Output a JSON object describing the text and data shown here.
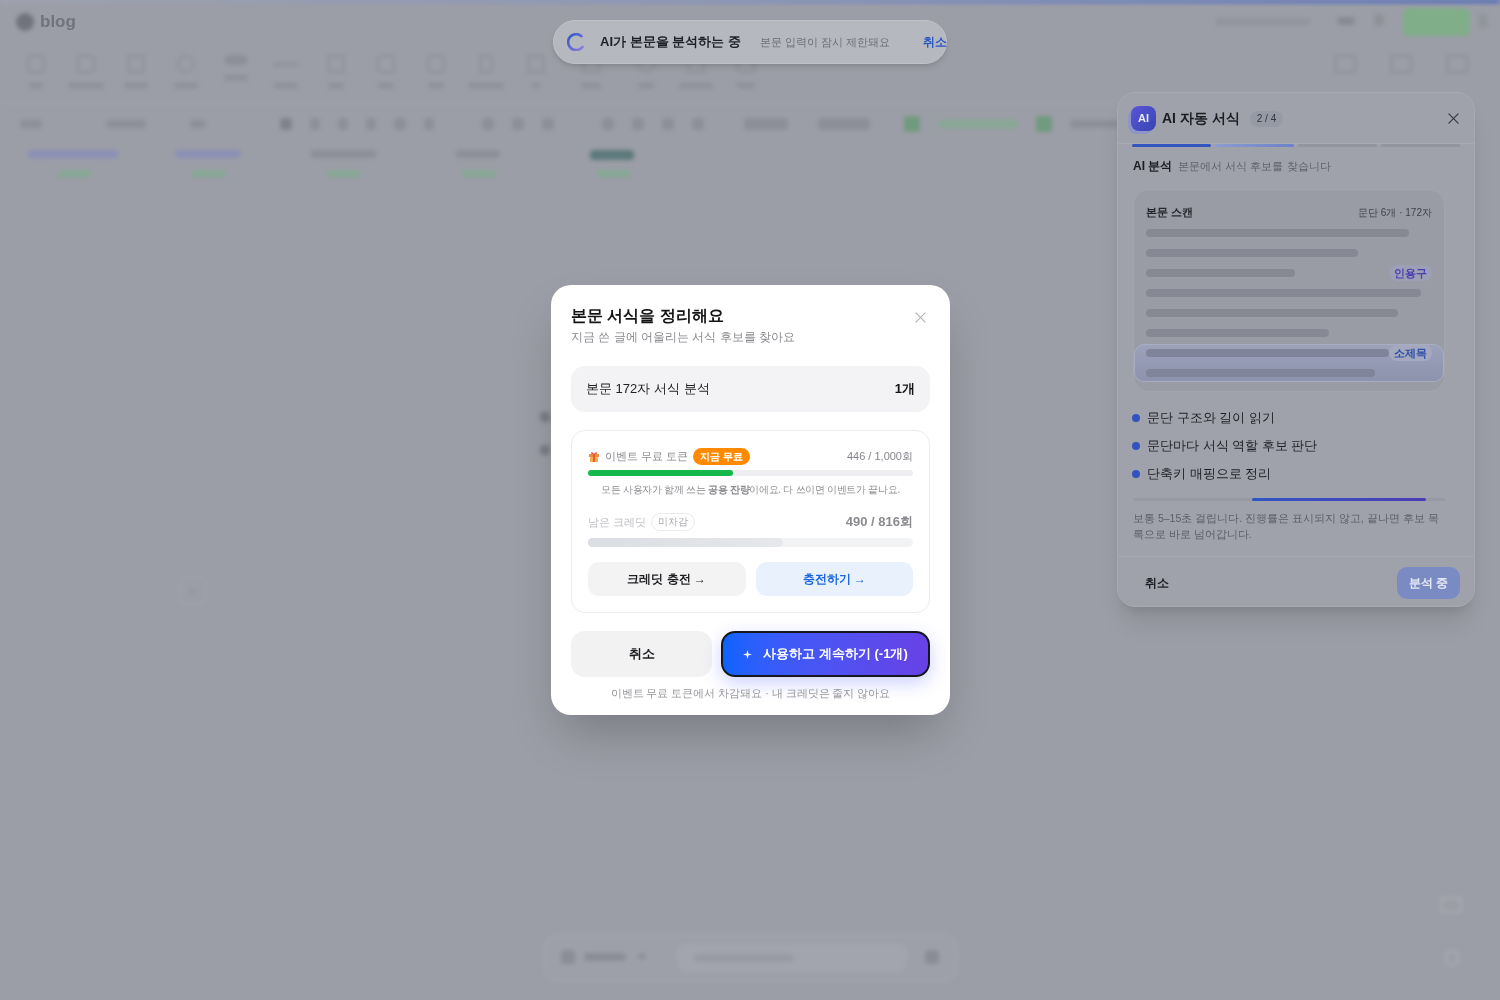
{
  "background": {
    "logo": "blog"
  },
  "toast": {
    "title": "AI가 본문을 분석하는 중",
    "message": "본문 입력이 잠시 제한돼요",
    "action": "취소"
  },
  "side_panel": {
    "logo": "AI",
    "title": "AI 자동 서식",
    "step_counter": "2 / 4",
    "steps": [
      {
        "completed": true,
        "current": false
      },
      {
        "completed": false,
        "current": true
      },
      {
        "completed": false,
        "current": false
      },
      {
        "completed": false,
        "current": false
      }
    ],
    "section_title": "AI 분석",
    "section_subtitle": "본문에서 서식 후보를 찾습니다",
    "scan": {
      "title": "본문 스캔",
      "meta": "문단 6개 · 172자",
      "lines": [
        {
          "highlighted": false
        },
        {
          "highlighted": false
        },
        {
          "highlighted": false,
          "tag": {
            "label": "인용구",
            "kind": "quote"
          }
        },
        {
          "highlighted": false
        },
        {
          "highlighted": false
        },
        {
          "highlighted": false
        },
        {
          "highlighted": true,
          "tag": {
            "label": "소제목",
            "kind": "subheading"
          }
        },
        {
          "highlighted": true
        }
      ]
    },
    "checklist": [
      "문단 구조와 길이 읽기",
      "문단마다 서식 역할 후보 판단",
      "단축키 매핑으로 정리"
    ],
    "progress": {
      "indeterminate": true
    },
    "note": "보통 5–15초 걸립니다. 진행률은 표시되지 않고, 끝나면 후보 목록으로 바로 넘어갑니다.",
    "cancel": "취소",
    "submit": {
      "label": "분석 중",
      "disabled": true
    }
  },
  "dialog": {
    "title": "본문 서식을 정리해요",
    "subtitle": "지금 쓴 글에 어울리는 서식 후보를 찾아요",
    "summary": {
      "label": "본문 172자 서식 분석",
      "count": "1개"
    },
    "event_tokens": {
      "label": "이벤트 무료 토큰",
      "badge": "지금 무료",
      "usage": "446 / 1,000회",
      "level": 0.446,
      "note": "모든 사용자가 함께 쓰는 **공용 잔량**이에요. 다 쓰이면 이벤트가 끝나요."
    },
    "credits": {
      "label": "남은 크레딧",
      "badge": "미차감",
      "usage": "490 / 816회",
      "level": 0.6,
      "muted": true
    },
    "credit_buttons": [
      {
        "label": "크레딧 충전 →",
        "kind": "secondary"
      },
      {
        "label": "충전하기 →",
        "kind": "accent"
      }
    ],
    "cancel": "취소",
    "confirm": {
      "label": "사용하고 계속하기 (-1개)",
      "focused": true
    },
    "footnote": "이벤트 무료 토큰에서 차감돼요 · 내 크레딧은 줄지 않아요"
  }
}
